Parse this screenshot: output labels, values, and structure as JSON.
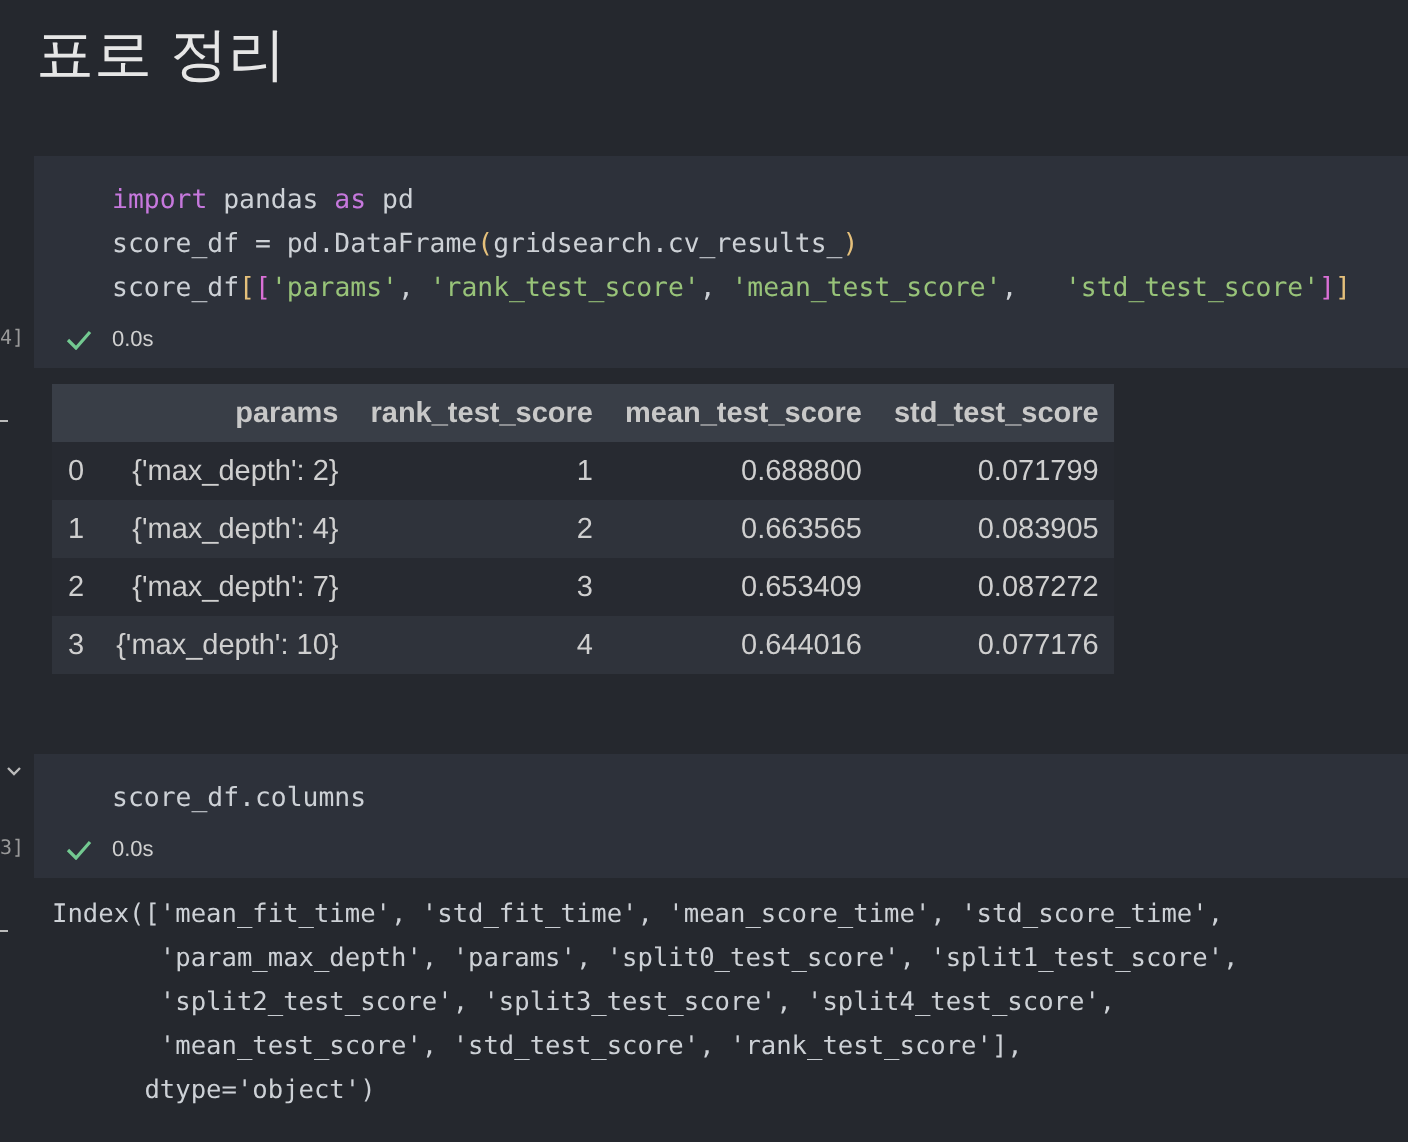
{
  "heading": "표로 정리",
  "cells": [
    {
      "exec_count": "4]",
      "code": [
        [
          {
            "kind": "keyword",
            "text": "import"
          },
          {
            "kind": "plain",
            "text": " pandas "
          },
          {
            "kind": "keyword",
            "text": "as"
          },
          {
            "kind": "plain",
            "text": " pd"
          }
        ],
        [
          {
            "kind": "plain",
            "text": "score_df = pd.DataFrame"
          },
          {
            "kind": "bracket1",
            "text": "("
          },
          {
            "kind": "plain",
            "text": "gridsearch.cv_results_"
          },
          {
            "kind": "bracket1",
            "text": ")"
          }
        ],
        [
          {
            "kind": "plain",
            "text": "score_df"
          },
          {
            "kind": "bracket1",
            "text": "["
          },
          {
            "kind": "bracket2",
            "text": "["
          },
          {
            "kind": "string",
            "text": "'params'"
          },
          {
            "kind": "plain",
            "text": ", "
          },
          {
            "kind": "string",
            "text": "'rank_test_score'"
          },
          {
            "kind": "plain",
            "text": ", "
          },
          {
            "kind": "string",
            "text": "'mean_test_score'"
          },
          {
            "kind": "plain",
            "text": ",   "
          },
          {
            "kind": "string",
            "text": "'std_test_score'"
          },
          {
            "kind": "bracket2",
            "text": "]"
          },
          {
            "kind": "bracket1",
            "text": "]"
          }
        ]
      ],
      "status": "0.0s",
      "collapsible": false,
      "output": {
        "kind": "table",
        "columns": [
          "",
          "params",
          "rank_test_score",
          "mean_test_score",
          "std_test_score"
        ],
        "rows": [
          [
            "0",
            "{'max_depth': 2}",
            "1",
            "0.688800",
            "0.071799"
          ],
          [
            "1",
            "{'max_depth': 4}",
            "2",
            "0.663565",
            "0.083905"
          ],
          [
            "2",
            "{'max_depth': 7}",
            "3",
            "0.653409",
            "0.087272"
          ],
          [
            "3",
            "{'max_depth': 10}",
            "4",
            "0.644016",
            "0.077176"
          ]
        ]
      }
    },
    {
      "exec_count": "3]",
      "code": [
        [
          {
            "kind": "plain",
            "text": "score_df.columns"
          }
        ]
      ],
      "status": "0.0s",
      "collapsible": true,
      "output": {
        "kind": "text",
        "lines": [
          "Index(['mean_fit_time', 'std_fit_time', 'mean_score_time', 'std_score_time',",
          "       'param_max_depth', 'params', 'split0_test_score', 'split1_test_score',",
          "       'split2_test_score', 'split3_test_score', 'split4_test_score',",
          "       'mean_test_score', 'std_test_score', 'rank_test_score'],",
          "      dtype='object')"
        ]
      }
    }
  ]
}
